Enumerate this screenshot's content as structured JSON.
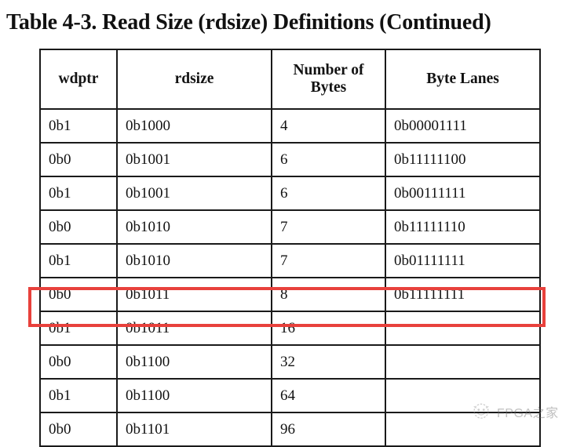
{
  "document": {
    "caption": "Table 4-3. Read Size (rdsize) Definitions (Continued)"
  },
  "table": {
    "headers": [
      "wdptr",
      "rdsize",
      "Number of Bytes",
      "Byte Lanes"
    ],
    "rows": [
      {
        "wdptr": "0b1",
        "rdsize": "0b1000",
        "bytes": "4",
        "lanes": "0b00001111"
      },
      {
        "wdptr": "0b0",
        "rdsize": "0b1001",
        "bytes": "6",
        "lanes": "0b11111100"
      },
      {
        "wdptr": "0b1",
        "rdsize": "0b1001",
        "bytes": "6",
        "lanes": "0b00111111"
      },
      {
        "wdptr": "0b0",
        "rdsize": "0b1010",
        "bytes": "7",
        "lanes": "0b11111110"
      },
      {
        "wdptr": "0b1",
        "rdsize": "0b1010",
        "bytes": "7",
        "lanes": "0b01111111"
      },
      {
        "wdptr": "0b0",
        "rdsize": "0b1011",
        "bytes": "8",
        "lanes": "0b11111111"
      },
      {
        "wdptr": "0b1",
        "rdsize": "0b1011",
        "bytes": "16",
        "lanes": ""
      },
      {
        "wdptr": "0b0",
        "rdsize": "0b1100",
        "bytes": "32",
        "lanes": ""
      },
      {
        "wdptr": "0b1",
        "rdsize": "0b1100",
        "bytes": "64",
        "lanes": ""
      },
      {
        "wdptr": "0b0",
        "rdsize": "0b1101",
        "bytes": "96",
        "lanes": ""
      }
    ],
    "highlighted_row_index": 5
  },
  "annotation": {
    "color": "#e8413c",
    "kind": "rectangle-highlight"
  },
  "watermark": {
    "text": "FPGA之家",
    "icon": "fpga-home-logo-icon"
  }
}
